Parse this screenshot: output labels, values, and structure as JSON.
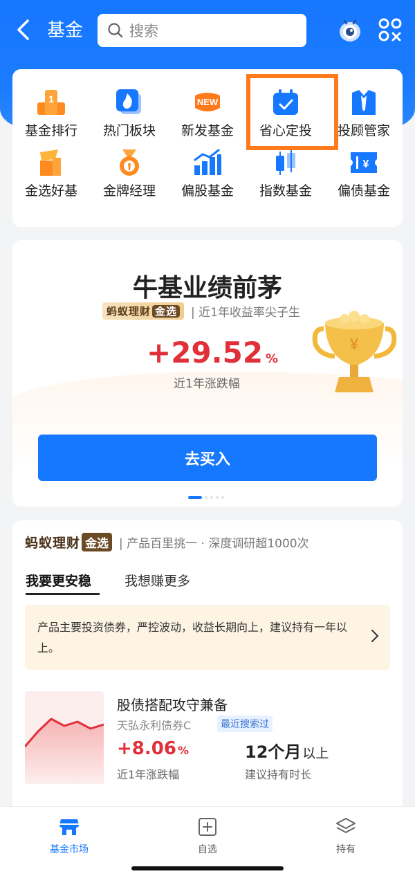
{
  "header": {
    "title": "基金",
    "search_placeholder": "搜索"
  },
  "grid": {
    "items": [
      {
        "label": "基金排行",
        "icon": "ranking-icon"
      },
      {
        "label": "热门板块",
        "icon": "hot-sector-icon"
      },
      {
        "label": "新发基金",
        "icon": "new-fund-icon",
        "badge": "NEW"
      },
      {
        "label": "省心定投",
        "icon": "auto-invest-icon"
      },
      {
        "label": "投顾管家",
        "icon": "advisor-icon"
      },
      {
        "label": "金选好基",
        "icon": "gold-pick-icon"
      },
      {
        "label": "金牌经理",
        "icon": "gold-manager-icon"
      },
      {
        "label": "偏股基金",
        "icon": "stock-fund-icon"
      },
      {
        "label": "指数基金",
        "icon": "index-fund-icon"
      },
      {
        "label": "偏债基金",
        "icon": "bond-fund-icon"
      }
    ]
  },
  "promo": {
    "title": "牛基业绩前茅",
    "brand": "蚂蚁理财",
    "brand_badge": "金选",
    "brand_sub": "| 近1年收益率尖子生",
    "return_value": "+29.52",
    "return_unit": "%",
    "return_caption": "近1年涨跌幅",
    "buy_label": "去买入",
    "trophy_symbol": "¥"
  },
  "list": {
    "brand": "蚂蚁理财",
    "brand_badge": "金选",
    "brand_sub": "| 产品百里挑一 · 深度调研超1000次",
    "tabs": [
      "我要更安稳",
      "我想赚更多"
    ],
    "notice": "产品主要投资债券，严控波动，收益长期向上，建议持有一年以上。",
    "fund": {
      "title": "股债搭配攻守兼备",
      "name": "天弘永利债券C",
      "badge": "最近搜索过",
      "return_value": "+8.06",
      "return_unit": "%",
      "return_caption": "近1年涨跌幅",
      "hold_value": "12个月",
      "hold_unit": "以上",
      "hold_caption": "建议持有时长",
      "spark": [
        40,
        62,
        80,
        70,
        76,
        66,
        72
      ]
    }
  },
  "tabbar": {
    "items": [
      {
        "label": "基金市场",
        "icon": "market-icon",
        "active": true
      },
      {
        "label": "自选",
        "icon": "watchlist-icon",
        "active": false
      },
      {
        "label": "持有",
        "icon": "holdings-icon",
        "active": false
      }
    ]
  },
  "colors": {
    "primary": "#1677ff",
    "accent_red": "#e0303a",
    "highlight_orange": "#ff7a1a",
    "icon_orange": "#ff9a2a"
  }
}
